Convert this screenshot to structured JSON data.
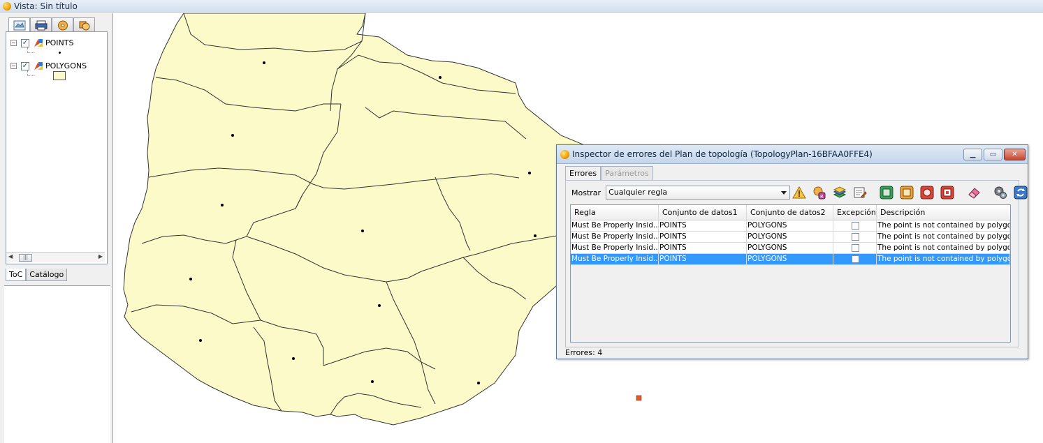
{
  "window": {
    "title": "Vista: Sin título"
  },
  "toc": {
    "top_tabs": [
      {
        "name": "layers-tab-icon"
      },
      {
        "name": "print-tab-icon"
      },
      {
        "name": "disc-tab-icon"
      },
      {
        "name": "shapes-tab-icon"
      }
    ],
    "layers": [
      {
        "name": "POINTS",
        "checked": true
      },
      {
        "name": "POLYGONS",
        "checked": true
      }
    ],
    "bottom_tabs": [
      "ToC",
      "Catálogo"
    ]
  },
  "dialog": {
    "title": "Inspector de errores del Plan de topología (TopologyPlan-16BFAA0FFE4)",
    "tabs": [
      "Errores",
      "Parámetros"
    ],
    "show_label": "Mostrar",
    "show_value": "Cualquier regla",
    "columns": [
      "Regla",
      "Conjunto de datos1",
      "Conjunto de datos2",
      "Excepción",
      "Descripción"
    ],
    "rows": [
      {
        "rule": "Must Be Properly Insid...",
        "ds1": "POINTS",
        "ds2": "POLYGONS",
        "exception": false,
        "desc": "The point is not contained by polygon.",
        "selected": false
      },
      {
        "rule": "Must Be Properly Insid...",
        "ds1": "POINTS",
        "ds2": "POLYGONS",
        "exception": false,
        "desc": "The point is not contained by polygon.",
        "selected": false
      },
      {
        "rule": "Must Be Properly Insid...",
        "ds1": "POINTS",
        "ds2": "POLYGONS",
        "exception": false,
        "desc": "The point is not contained by polygon.",
        "selected": false
      },
      {
        "rule": "Must Be Properly Insid...",
        "ds1": "POINTS",
        "ds2": "POLYGONS",
        "exception": false,
        "desc": "The point is not contained by polygon.",
        "selected": true
      }
    ],
    "status": "Errores: 4",
    "toolbar_icons": [
      "warning-icon",
      "mark-exception-icon",
      "layers-icon",
      "edit-properties-icon",
      "zoom-to-error-icon",
      "zoom-to-feature-icon",
      "zoom-to-geometry-icon",
      "select-feature-icon",
      "eraser-icon",
      "gears-icon",
      "refresh-icon"
    ]
  },
  "colors": {
    "polygon_fill": "#fbfac8",
    "selection": "#3399ff",
    "error_marker": "#e6581f"
  }
}
